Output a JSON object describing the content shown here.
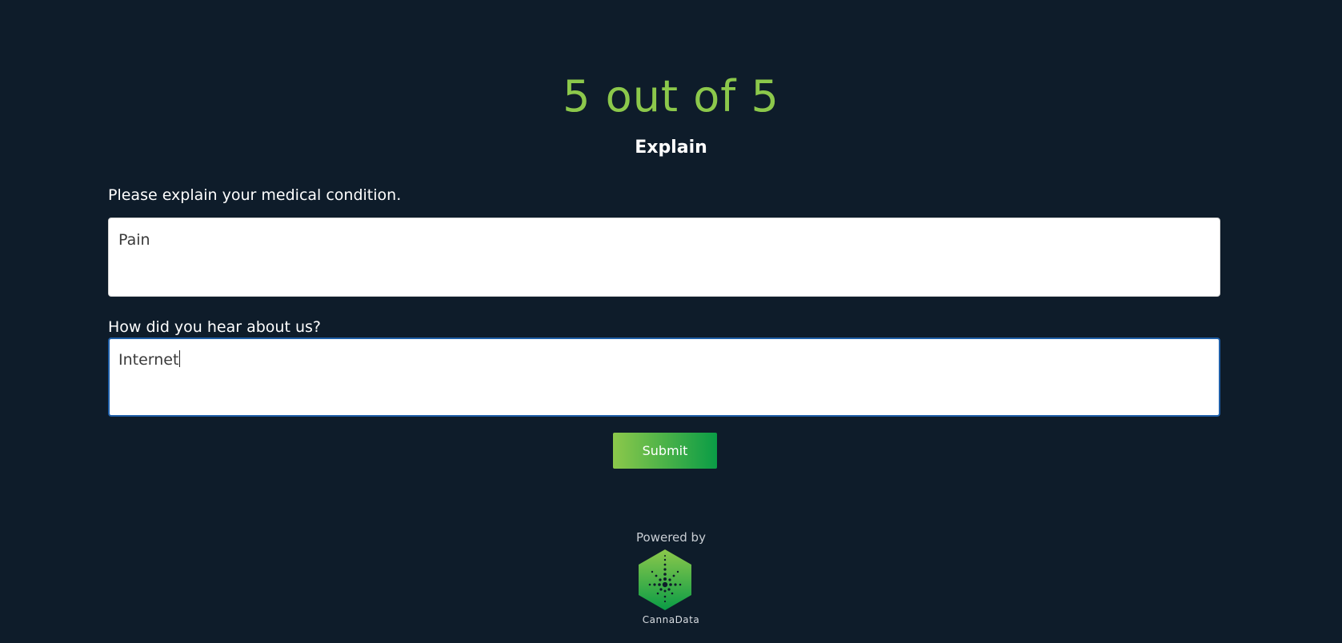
{
  "header": {
    "progress_text": "5 out of 5",
    "section_title": "Explain"
  },
  "form": {
    "condition": {
      "label": "Please explain your medical condition.",
      "value": "Pain"
    },
    "referral": {
      "label": "How did you hear about us?",
      "value": "Internet"
    },
    "submit_label": "Submit"
  },
  "footer": {
    "powered_by": "Powered by",
    "brand_name": "CannaData"
  },
  "colors": {
    "background": "#0e1c2a",
    "accent_green": "#8cc84b",
    "button_gradient_end": "#0a9c46",
    "focus_border": "#1f5fa8"
  },
  "icons": {
    "logo": "cannadata-hexagon-leaf-icon"
  }
}
